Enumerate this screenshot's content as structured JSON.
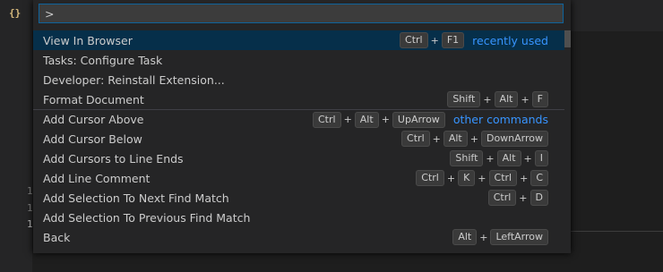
{
  "editor": {
    "braces_icon": "{}",
    "line_numbers": [
      "1",
      "1",
      "1"
    ]
  },
  "quick_open": {
    "input_value": ">",
    "items": [
      {
        "label": "View In Browser",
        "keys": [
          "Ctrl",
          "F1"
        ],
        "group": "recently used",
        "selected": true
      },
      {
        "label": "Tasks: Configure Task",
        "keys": []
      },
      {
        "label": "Developer: Reinstall Extension...",
        "keys": []
      },
      {
        "label": "Format Document",
        "keys": [
          "Shift",
          "Alt",
          "F"
        ]
      },
      {
        "label": "Add Cursor Above",
        "keys": [
          "Ctrl",
          "Alt",
          "UpArrow"
        ],
        "group": "other commands"
      },
      {
        "label": "Add Cursor Below",
        "keys": [
          "Ctrl",
          "Alt",
          "DownArrow"
        ]
      },
      {
        "label": "Add Cursors to Line Ends",
        "keys": [
          "Shift",
          "Alt",
          "I"
        ]
      },
      {
        "label": "Add Line Comment",
        "keys": [
          "Ctrl",
          "K",
          "Ctrl",
          "C"
        ]
      },
      {
        "label": "Add Selection To Next Find Match",
        "keys": [
          "Ctrl",
          "D"
        ]
      },
      {
        "label": "Add Selection To Previous Find Match",
        "keys": []
      },
      {
        "label": "Back",
        "keys": [
          "Alt",
          "LeftArrow"
        ]
      }
    ]
  },
  "colors": {
    "accent": "#3794ff",
    "selected_row": "#062f4a",
    "input_border": "#0e639c"
  }
}
